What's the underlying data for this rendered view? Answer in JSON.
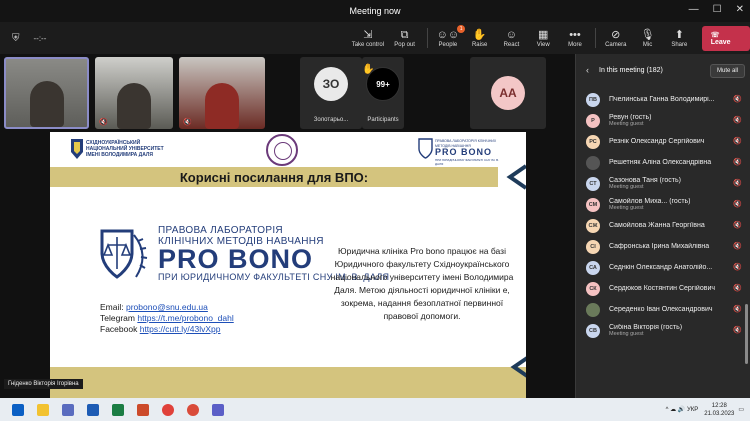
{
  "window": {
    "title": "Meeting now",
    "controls": [
      "—",
      "☐",
      "✕"
    ]
  },
  "toolbar": {
    "timer": "--:--",
    "items": [
      {
        "label": "Take control",
        "icon": "take-control-icon",
        "glyph": "✋"
      },
      {
        "label": "Pop out",
        "icon": "pop-out-icon",
        "glyph": "⧉"
      },
      {
        "label": "People",
        "icon": "people-icon",
        "glyph": "👥",
        "badge": "1"
      },
      {
        "label": "Raise",
        "icon": "raise-hand-icon",
        "glyph": "✋"
      },
      {
        "label": "React",
        "icon": "react-icon",
        "glyph": "☺"
      },
      {
        "label": "View",
        "icon": "view-icon",
        "glyph": "▦"
      },
      {
        "label": "More",
        "icon": "more-icon",
        "glyph": "…"
      },
      {
        "label": "Camera",
        "icon": "camera-icon",
        "glyph": "📷"
      },
      {
        "label": "Mic",
        "icon": "mic-icon",
        "glyph": "🎙"
      },
      {
        "label": "Share",
        "icon": "share-icon",
        "glyph": "⬆"
      }
    ],
    "leave": "Leave"
  },
  "stage": {
    "tiles": [
      {
        "initials": "ЗО",
        "label": "Золотарьо..."
      },
      {
        "initials": "99+",
        "label": "Participants"
      },
      {
        "initials": "AA",
        "label": ""
      }
    ],
    "speaker_name": "Гніденко Вікторія Ігорівна"
  },
  "slide": {
    "university": [
      "СХІДНОУКРАЇНСЬКИЙ",
      "НАЦІОНАЛЬНИЙ УНІВЕРСИТЕТ",
      "ІМЕНІ ВОЛОДИМИРА ДАЛЯ"
    ],
    "logo_small": {
      "top": "ПРАВОВА ЛАБОРАТОРІЯ КЛІНІЧНИХ МЕТОДІВ НАВЧАННЯ",
      "brand": "PRO BONO",
      "sub": "ПРИ ЮРИДИЧНОМУ ФАКУЛЬТЕТІ СНУ ІМ. В. ДАЛЯ"
    },
    "heading": "Корисні посилання для ВПО:",
    "lab_line1": "ПРАВОВА ЛАБОРАТОРІЯ",
    "lab_line2": "КЛІНІЧНИХ МЕТОДІВ НАВЧАННЯ",
    "brand": "PRO BONO",
    "faculty": "ПРИ ЮРИДИЧНОМУ ФАКУЛЬТЕТІ СНУ ІМ. В. ДАЛЯ",
    "description": "Юридична клініка Pro bono працює на базі Юридичного факультету Східноукраїнського національного університету імені Володимира Даля. Метою діяльності юридичної клініки е, зокрема, надання безоплатної первинної правової допомоги.",
    "email_label": "Email:",
    "email": "probono@snu.edu.ua",
    "telegram_label": "Telegram",
    "telegram": "https://t.me/probono_dahl",
    "facebook_label": "Facebook",
    "facebook": "https://cutt.ly/43lvXpp"
  },
  "panel": {
    "title": "In this meeting (182)",
    "mute_all": "Mute all",
    "participants": [
      {
        "initials": "ПВ",
        "name": "Пчелинська Ганна Володимирі...",
        "sub": "",
        "color": "#c9d6ee"
      },
      {
        "initials": "Р",
        "name": "Ревун (гость)",
        "sub": "Meeting guest",
        "color": "#f5c2c2"
      },
      {
        "initials": "РС",
        "name": "Резнік Олександр Сергійович",
        "sub": "",
        "color": "#f6d6b3"
      },
      {
        "initials": "",
        "name": "Решетняк Аліна Олександрівна",
        "sub": "",
        "color": "#555555",
        "photo": true
      },
      {
        "initials": "СТ",
        "name": "Сазонова Таня (гость)",
        "sub": "Meeting guest",
        "color": "#c9d6ee"
      },
      {
        "initials": "СМ",
        "name": "Самойлов Миха... (гость)",
        "sub": "Meeting guest",
        "color": "#f5c2c2"
      },
      {
        "initials": "СЖ",
        "name": "Самойлова Жанна Георгіївна",
        "sub": "",
        "color": "#f6d6b3"
      },
      {
        "initials": "СІ",
        "name": "Сафронська Ірина Михайлівна",
        "sub": "",
        "color": "#f6d6b3"
      },
      {
        "initials": "СА",
        "name": "Седнкін Олександр Анатолійо...",
        "sub": "",
        "color": "#c9d6ee"
      },
      {
        "initials": "СК",
        "name": "Сердюков Костянтин Сергійович",
        "sub": "",
        "color": "#f5c2c2"
      },
      {
        "initials": "",
        "name": "Середенко Іван Олександрович",
        "sub": "",
        "color": "#6a7a5a",
        "photo": true
      },
      {
        "initials": "СВ",
        "name": "Сибіна Вікторія (гость)",
        "sub": "Meeting guest",
        "color": "#c9d6ee"
      }
    ]
  },
  "taskbar": {
    "lang": "УКР",
    "time": "12:28",
    "date": "21.03.2023"
  }
}
